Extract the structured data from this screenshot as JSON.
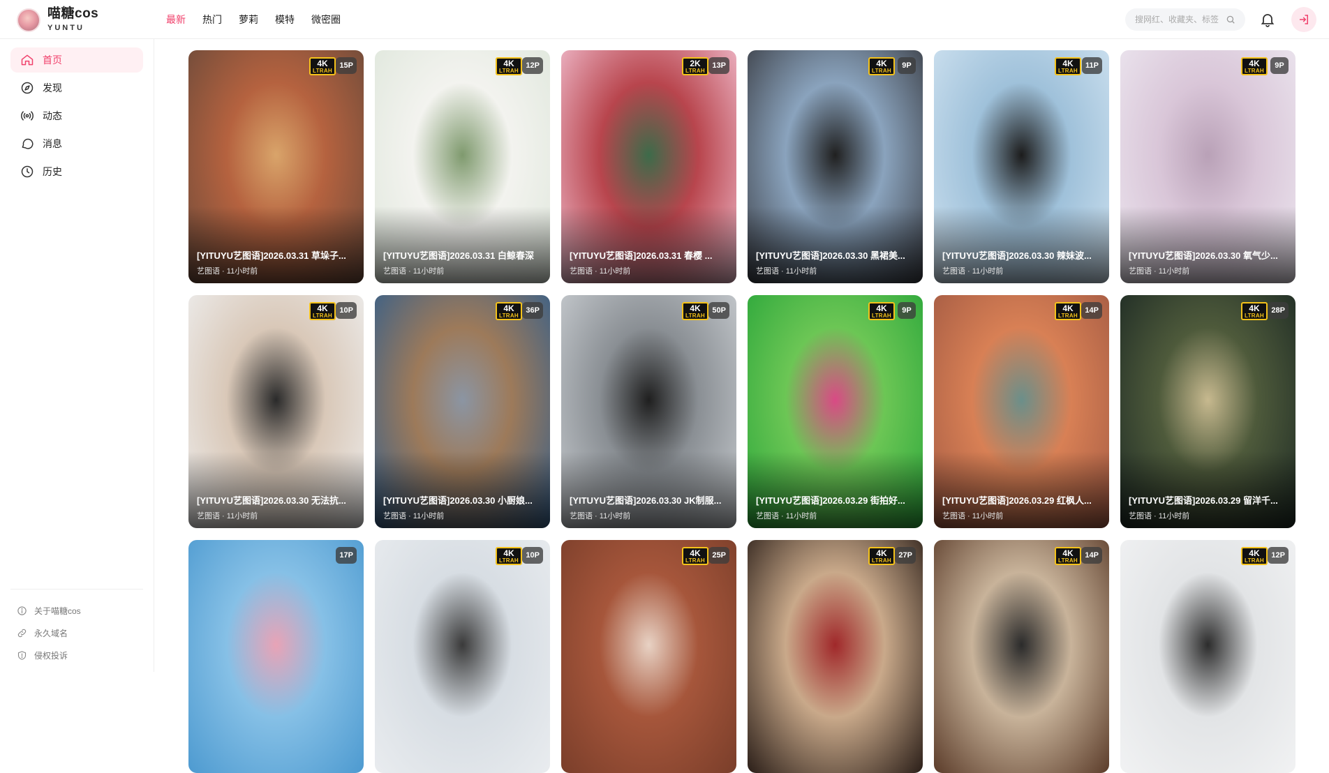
{
  "header": {
    "logo_title": "喵糖cos",
    "logo_sub": "YUNTU",
    "nav": [
      {
        "label": "最新",
        "active": true
      },
      {
        "label": "热门",
        "active": false
      },
      {
        "label": "萝莉",
        "active": false
      },
      {
        "label": "模特",
        "active": false
      },
      {
        "label": "微密圈",
        "active": false
      }
    ],
    "search_placeholder": "搜网红、收藏夹、标签",
    "accent_color": "#f0406b"
  },
  "sidebar": {
    "items": [
      {
        "label": "首页",
        "icon": "home-icon",
        "active": true
      },
      {
        "label": "发现",
        "icon": "compass-icon",
        "active": false
      },
      {
        "label": "动态",
        "icon": "broadcast-icon",
        "active": false
      },
      {
        "label": "消息",
        "icon": "message-icon",
        "active": false
      },
      {
        "label": "历史",
        "icon": "clock-icon",
        "active": false
      }
    ],
    "footer": [
      {
        "label": "关于喵糖cos",
        "icon": "info-icon"
      },
      {
        "label": "永久域名",
        "icon": "link-icon"
      },
      {
        "label": "侵权投诉",
        "icon": "shield-icon"
      }
    ]
  },
  "cards": [
    {
      "title": "[YITUYU艺图语]2026.03.31 草垛子...",
      "meta": "艺图语 · 11小时前",
      "res": "4K",
      "count": "15P",
      "colors": [
        "#6b4a3a",
        "#b5623f",
        "#d9a46a"
      ]
    },
    {
      "title": "[YITUYU艺图语]2026.03.31 白鲸春深",
      "meta": "艺图语 · 11小时前",
      "res": "4K",
      "count": "12P",
      "colors": [
        "#dfe7dc",
        "#f3f3ef",
        "#7f9a6e"
      ]
    },
    {
      "title": "[YITUYU艺图语]2026.03.31 春樱 ...",
      "meta": "艺图语 · 11小时前",
      "res": "2K",
      "count": "13P",
      "colors": [
        "#f2bfd0",
        "#b8454d",
        "#3d6b4a"
      ]
    },
    {
      "title": "[YITUYU艺图语]2026.03.30 黑裙美...",
      "meta": "艺图语 · 11小时前",
      "res": "4K",
      "count": "9P",
      "colors": [
        "#3a3d44",
        "#8aa3bd",
        "#202020"
      ]
    },
    {
      "title": "[YITUYU艺图语]2026.03.30 辣妹波...",
      "meta": "艺图语 · 11小时前",
      "res": "4K",
      "count": "11P",
      "colors": [
        "#cfe2f0",
        "#9fc1da",
        "#1c1c1c"
      ]
    },
    {
      "title": "[YITUYU艺图语]2026.03.30 氧气少...",
      "meta": "艺图语 · 11小时前",
      "res": "4K",
      "count": "9P",
      "colors": [
        "#ece6ef",
        "#d9c6d8",
        "#b9a1b7"
      ]
    },
    {
      "title": "[YITUYU艺图语]2026.03.30 无法抗...",
      "meta": "艺图语 · 11小时前",
      "res": "4K",
      "count": "10P",
      "colors": [
        "#eeeeee",
        "#d9c8b8",
        "#2a2a2a"
      ]
    },
    {
      "title": "[YITUYU艺图语]2026.03.30 小厨娘...",
      "meta": "艺图语 · 11小时前",
      "res": "4K",
      "count": "36P",
      "colors": [
        "#355f8a",
        "#9d7a5a",
        "#8b95a3"
      ]
    },
    {
      "title": "[YITUYU艺图语]2026.03.30 JK制服...",
      "meta": "艺图语 · 11小时前",
      "res": "4K",
      "count": "50P",
      "colors": [
        "#c9cdd1",
        "#8a8f94",
        "#1f1f1f"
      ]
    },
    {
      "title": "[YITUYU艺图语]2026.03.29 街拍好...",
      "meta": "艺图语 · 11小时前",
      "res": "4K",
      "count": "9P",
      "colors": [
        "#2aa63a",
        "#6cc655",
        "#d94a85"
      ]
    },
    {
      "title": "[YITUYU艺图语]2026.03.29 红枫人...",
      "meta": "艺图语 · 11小时前",
      "res": "4K",
      "count": "14P",
      "colors": [
        "#a35a43",
        "#d88055",
        "#6b8f8a"
      ]
    },
    {
      "title": "[YITUYU艺图语]2026.03.29 留洋千...",
      "meta": "艺图语 · 11小时前",
      "res": "4K",
      "count": "28P",
      "colors": [
        "#1d2a24",
        "#4e5a3b",
        "#c7b98f"
      ]
    },
    {
      "title": "",
      "meta": "",
      "res": "",
      "count": "17P",
      "colors": [
        "#4d9ad0",
        "#86c0e6",
        "#e8a3b6"
      ]
    },
    {
      "title": "",
      "meta": "",
      "res": "4K",
      "count": "10P",
      "colors": [
        "#e9ecef",
        "#d7dde3",
        "#3a3a3a"
      ]
    },
    {
      "title": "",
      "meta": "",
      "res": "4K",
      "count": "25P",
      "colors": [
        "#7a3e2a",
        "#a6563b",
        "#e8d2c4"
      ]
    },
    {
      "title": "",
      "meta": "",
      "res": "4K",
      "count": "27P",
      "colors": [
        "#2a1e18",
        "#c9a98a",
        "#a0282a"
      ]
    },
    {
      "title": "",
      "meta": "",
      "res": "4K",
      "count": "14P",
      "colors": [
        "#5b3c2a",
        "#c8b39a",
        "#2b2b2b"
      ]
    },
    {
      "title": "",
      "meta": "",
      "res": "4K",
      "count": "12P",
      "colors": [
        "#f1f2f3",
        "#e2e4e6",
        "#2c2c2c"
      ]
    }
  ]
}
